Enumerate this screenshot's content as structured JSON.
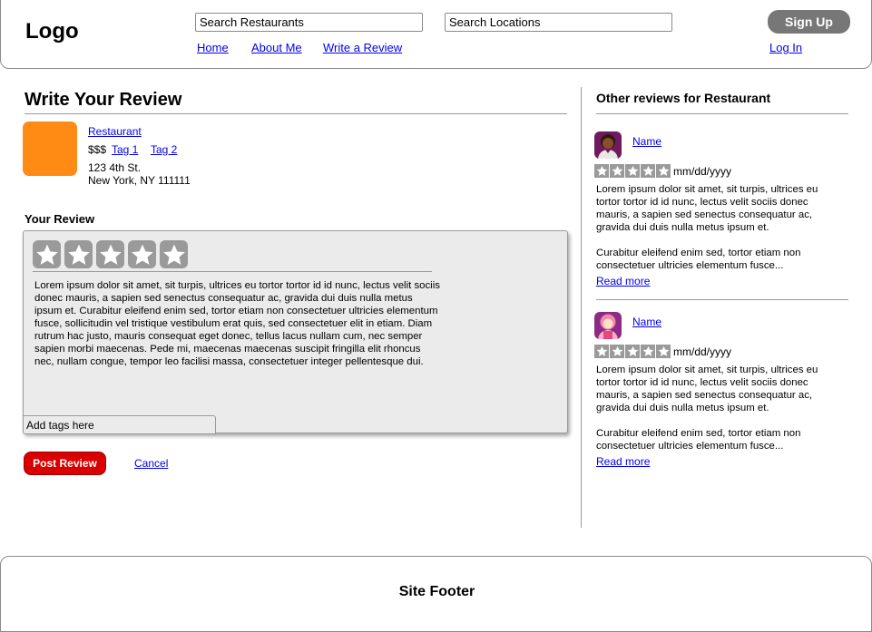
{
  "header": {
    "logo": "Logo",
    "search_restaurants_value": "Search Restaurants",
    "search_locations_value": "Search Locations",
    "nav": [
      {
        "label": "Home"
      },
      {
        "label": "About Me"
      },
      {
        "label": "Write a Review"
      }
    ],
    "signup_label": "Sign Up",
    "login_label": "Log In"
  },
  "main": {
    "title": "Write Your Review",
    "business": {
      "name": "Restaurant",
      "price": "$$$",
      "tags": [
        "Tag 1",
        "Tag 2"
      ],
      "address_line1": "123 4th St.",
      "address_line2": "New York, NY 111111",
      "thumbnail_color": "#ff8a14"
    },
    "review_label": "Your Review",
    "rating": {
      "selected": 0,
      "max": 5,
      "icon": "star-icon"
    },
    "review_text": "Lorem ipsum dolor sit amet, sit turpis, ultrices eu tortor tortor id id nunc, lectus velit sociis donec mauris, a sapien sed senectus consequatur ac, gravida dui duis nulla metus ipsum et. Curabitur eleifend enim sed, tortor etiam non consectetuer ultricies elementum fusce, sollicitudin vel tristique vestibulum erat quis, sed consectetuer elit in etiam. Diam rutrum hac justo, mauris consequat eget donec, tellus lacus nullam cum, nec semper sapien morbi maecenas. Pede mi, maecenas maecenas suscipit fringilla elit rhoncus nec, nullam congue, tempor leo facilisi massa, consectetuer integer pellentesque dui.",
    "tags_placeholder": "Add tags here",
    "post_label": "Post Review",
    "cancel_label": "Cancel",
    "post_color": "#d80000"
  },
  "sidebar": {
    "title": "Other reviews for Restaurant",
    "reviews": [
      {
        "name": "Name",
        "date": "mm/dd/yyyy",
        "stars": 5,
        "p1": "Lorem ipsum dolor sit amet, sit turpis, ultrices eu tortor tortor id id nunc, lectus velit sociis donec mauris, a sapien sed senectus consequatur ac, gravida dui duis nulla metus ipsum et.",
        "p2": "Curabitur eleifend enim sed, tortor etiam non consectetuer ultricies elementum fusce...",
        "read_more": "Read more",
        "avatar_icon": "person-avatar-icon"
      },
      {
        "name": "Name",
        "date": "mm/dd/yyyy",
        "stars": 5,
        "p1": "Lorem ipsum dolor sit amet, sit turpis, ultrices eu tortor tortor id id nunc, lectus velit sociis donec mauris, a sapien sed senectus consequatur ac, gravida dui duis nulla metus ipsum et.",
        "p2": "Curabitur eleifend enim sed, tortor etiam non consectetuer ultricies elementum fusce...",
        "read_more": "Read more",
        "avatar_icon": "person-avatar-icon"
      }
    ]
  },
  "footer": {
    "label": "Site Footer"
  }
}
